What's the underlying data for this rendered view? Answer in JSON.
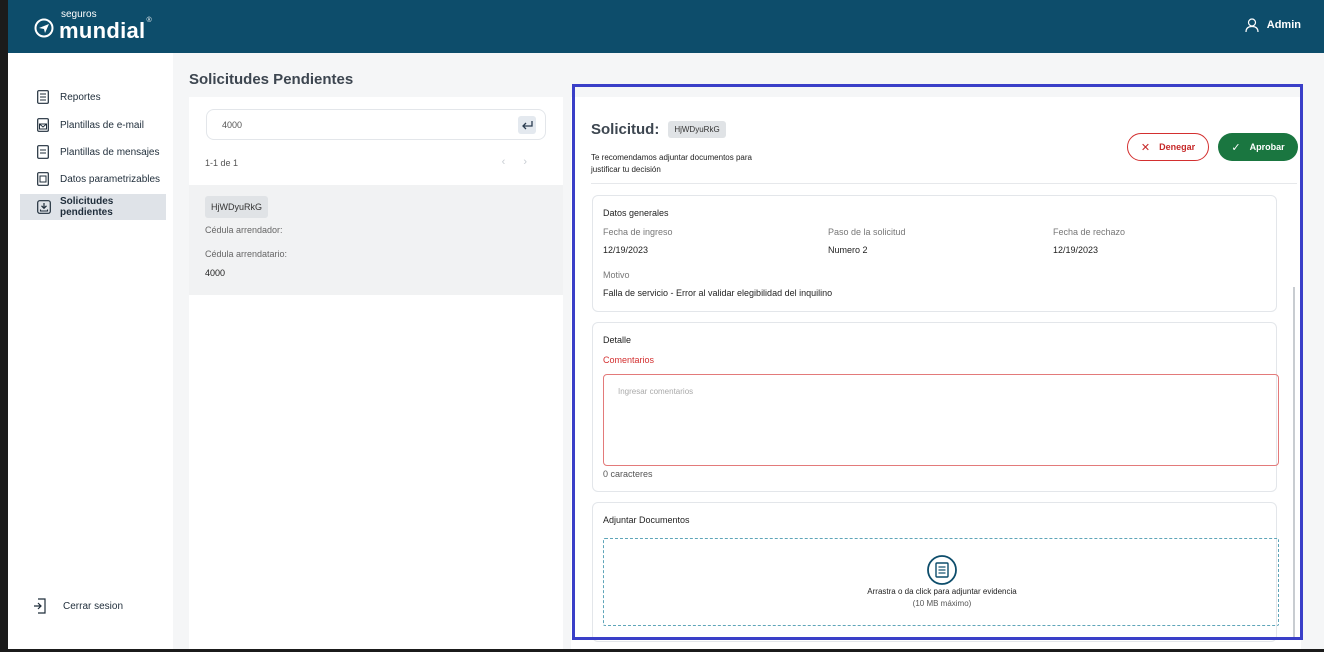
{
  "header": {
    "brand_small": "seguros",
    "brand_big": "mundial",
    "brand_reg": "®",
    "user_label": "Admin",
    "user_icon": "user-icon"
  },
  "sidebar": {
    "items": [
      {
        "label": "Reportes",
        "icon": "report-icon",
        "active": false
      },
      {
        "label": "Plantillas de e-mail",
        "icon": "email-template-icon",
        "active": false
      },
      {
        "label": "Plantillas de mensajes",
        "icon": "message-template-icon",
        "active": false
      },
      {
        "label": "Datos parametrizables",
        "icon": "data-icon",
        "active": false
      },
      {
        "label": "Solicitudes pendientes",
        "icon": "pending-requests-icon",
        "active": true
      }
    ],
    "logout_label": "Cerrar sesion"
  },
  "main": {
    "title": "Solicitudes Pendientes",
    "search_value": "4000",
    "pager": "1-1 de 1",
    "results": [
      {
        "code": "HjWDyuRkG",
        "landlord_label": "Cédula arrendador:",
        "tenant_label": "Cédula arrendatario:",
        "tenant_value": "4000"
      }
    ]
  },
  "detail": {
    "title": "Solicitud:",
    "code": "HjWDyuRkG",
    "hint": "Te recomendamos adjuntar documentos para justificar tu decisión",
    "deny_label": "Denegar",
    "approve_label": "Aprobar",
    "general": {
      "title": "Datos generales",
      "entry_date_label": "Fecha de ingreso",
      "entry_date": "12/19/2023",
      "step_label": "Paso de la solicitud",
      "step": "Numero 2",
      "reject_date_label": "Fecha de rechazo",
      "reject_date": "12/19/2023",
      "reason_label": "Motivo",
      "reason": "Falla de servicio - Error al validar elegibilidad del inquilino"
    },
    "detail_card": {
      "title": "Detalle",
      "comments_label": "Comentarios",
      "comments_placeholder": "Ingresar comentarios",
      "counter": "0 caracteres"
    },
    "attach": {
      "title": "Adjuntar Documentos",
      "line1": "Arrastra o da click para adjuntar evidencia",
      "line2": "(10 MB máximo)"
    }
  },
  "colors": {
    "header_bg": "#0d4d6b",
    "approve": "#1a7640",
    "deny": "#d32f2f",
    "highlight_frame": "#3a3fc8"
  }
}
